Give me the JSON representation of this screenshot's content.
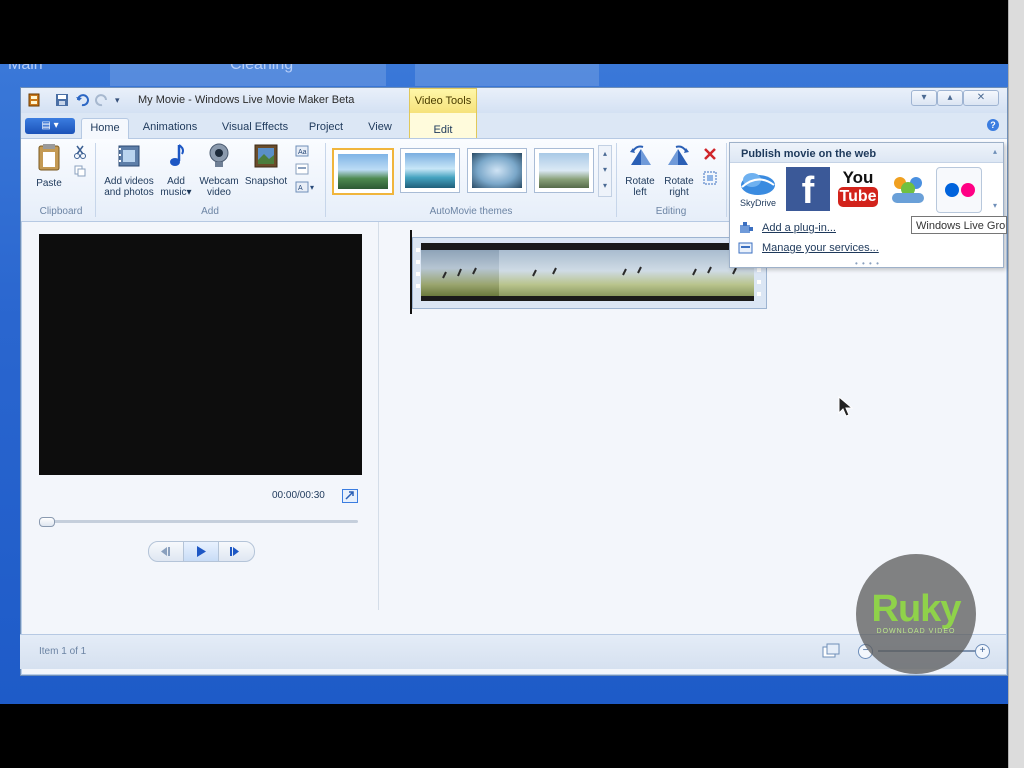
{
  "desktop": {
    "bg_left": "Main",
    "bg_mid": "Cleaning"
  },
  "window": {
    "title": "My Movie - Windows Live Movie Maker Beta",
    "context_tab_group": "Video Tools",
    "controls": {
      "minimize": "▾",
      "maximize": "▴",
      "close": "✕"
    }
  },
  "tabs": [
    {
      "label": "Home"
    },
    {
      "label": "Animations"
    },
    {
      "label": "Visual Effects"
    },
    {
      "label": "Project"
    },
    {
      "label": "View"
    },
    {
      "label": "Edit"
    }
  ],
  "ribbon": {
    "clipboard": {
      "paste": "Paste",
      "group": "Clipboard"
    },
    "add": {
      "add_videos": "Add videos",
      "add_videos_2": "and photos",
      "add_music": "Add",
      "add_music_2": "music",
      "webcam": "Webcam",
      "webcam_2": "video",
      "snapshot": "Snapshot",
      "group": "Add"
    },
    "themes": {
      "group": "AutoMovie themes"
    },
    "editing": {
      "rotate_left": "Rotate",
      "rotate_left_2": "left",
      "rotate_right": "Rotate",
      "rotate_right_2": "right",
      "group": "Editing"
    }
  },
  "flyout": {
    "header": "Publish movie on the web",
    "skydrive": "SkyDrive",
    "youtube_line1": "You",
    "youtube_line2": "Tube",
    "facebook": "f",
    "add_plugin": "Add a plug-in...",
    "manage_services": "Manage your services...",
    "tooltip": "Windows Live Groups"
  },
  "preview": {
    "time": "00:00/00:30"
  },
  "status": {
    "item": "Item 1 of 1"
  },
  "watermark": {
    "brand": "Ruky",
    "sub": "DOWNLOAD VIDEO"
  }
}
